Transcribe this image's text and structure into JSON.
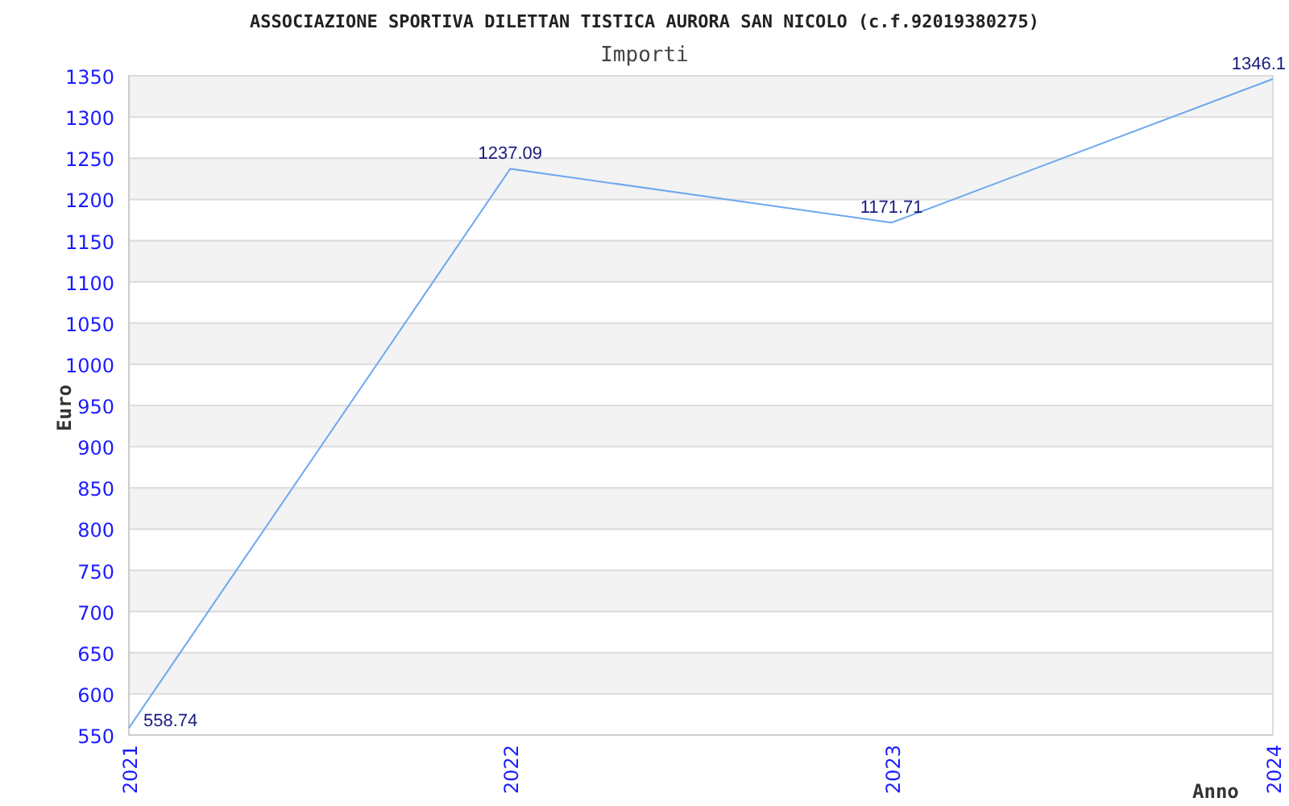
{
  "heading": "ASSOCIAZIONE SPORTIVA DILETTAN TISTICA AURORA SAN NICOLO (c.f.92019380275)",
  "chart_data": {
    "type": "line",
    "title": "Importi",
    "xlabel": "Anno",
    "ylabel": "Euro",
    "categories": [
      "2021",
      "2022",
      "2023",
      "2024"
    ],
    "series": [
      {
        "color": "#6fa8ef",
        "values": [
          558.74,
          1237.09,
          1171.71,
          1346.1
        ]
      }
    ],
    "value_labels": [
      "558.74",
      "1237.09",
      "1171.71",
      "1346.1"
    ],
    "ylim": [
      550,
      1350
    ],
    "yticks": [
      550,
      600,
      650,
      700,
      750,
      800,
      850,
      900,
      950,
      1000,
      1050,
      1100,
      1150,
      1200,
      1250,
      1300,
      1350
    ]
  }
}
